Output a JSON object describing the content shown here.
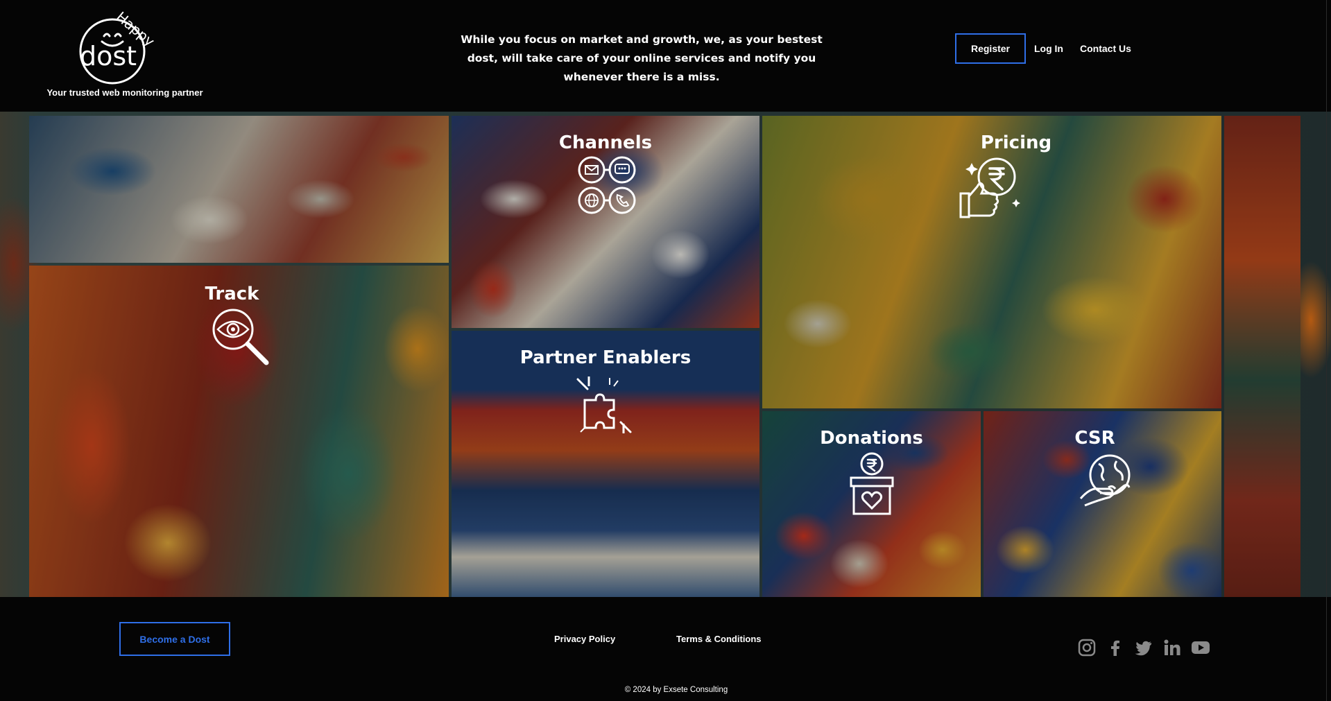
{
  "header": {
    "logo": {
      "small_word": "Happy",
      "big_word": "dost",
      "tagline": "Your trusted web monitoring partner"
    },
    "intro": "While you focus on market and growth, we, as your bestest dost, will take care of your online services and notify you whenever there is a miss.",
    "nav": {
      "register": "Register",
      "login": "Log In",
      "contact": "Contact Us"
    }
  },
  "tiles": {
    "channels": {
      "title": "Channels",
      "icon": "channels-icon"
    },
    "pricing": {
      "title": "Pricing",
      "icon": "rupee-thumbs-up-icon"
    },
    "track": {
      "title": "Track",
      "icon": "eye-magnifier-icon"
    },
    "partner_enablers": {
      "title": "Partner Enablers",
      "icon": "puzzle-hands-icon"
    },
    "donations": {
      "title": "Donations",
      "icon": "donation-box-icon"
    },
    "csr": {
      "title": "CSR",
      "icon": "globe-hand-icon"
    }
  },
  "footer": {
    "become_dost": "Become a Dost",
    "privacy": "Privacy Policy",
    "terms": "Terms & Conditions",
    "social": [
      "instagram-icon",
      "facebook-icon",
      "twitter-icon",
      "linkedin-icon",
      "youtube-icon"
    ],
    "copyright": "© 2024 by Exsete Consulting"
  },
  "colors": {
    "accent": "#2f6fe8",
    "background": "#050505",
    "text": "#ffffff"
  }
}
